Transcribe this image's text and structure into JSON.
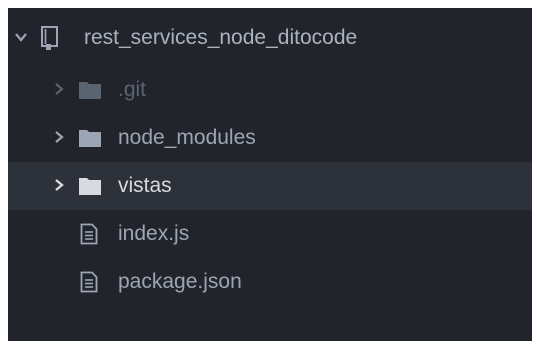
{
  "tree": {
    "root": {
      "label": "rest_services_node_ditocode",
      "expanded": true,
      "icon": "repo-icon"
    },
    "items": [
      {
        "label": ".git",
        "type": "folder",
        "icon": "folder-icon",
        "expanded": false,
        "ignored": true,
        "selected": false
      },
      {
        "label": "node_modules",
        "type": "folder",
        "icon": "folder-icon",
        "expanded": false,
        "ignored": false,
        "selected": false
      },
      {
        "label": "vistas",
        "type": "folder",
        "icon": "folder-icon",
        "expanded": false,
        "ignored": false,
        "selected": true
      },
      {
        "label": "index.js",
        "type": "file",
        "icon": "file-text-icon",
        "ignored": false,
        "selected": false
      },
      {
        "label": "package.json",
        "type": "file",
        "icon": "file-text-icon",
        "ignored": false,
        "selected": false
      }
    ]
  },
  "colors": {
    "panel_background": "#21252b",
    "selected_background": "#2c313a",
    "text": "#9da5b4",
    "ignored_text": "#5c6370",
    "selected_text": "#d7dae0",
    "folder": "#9da5b4",
    "folder_selected": "#d7dae0"
  }
}
